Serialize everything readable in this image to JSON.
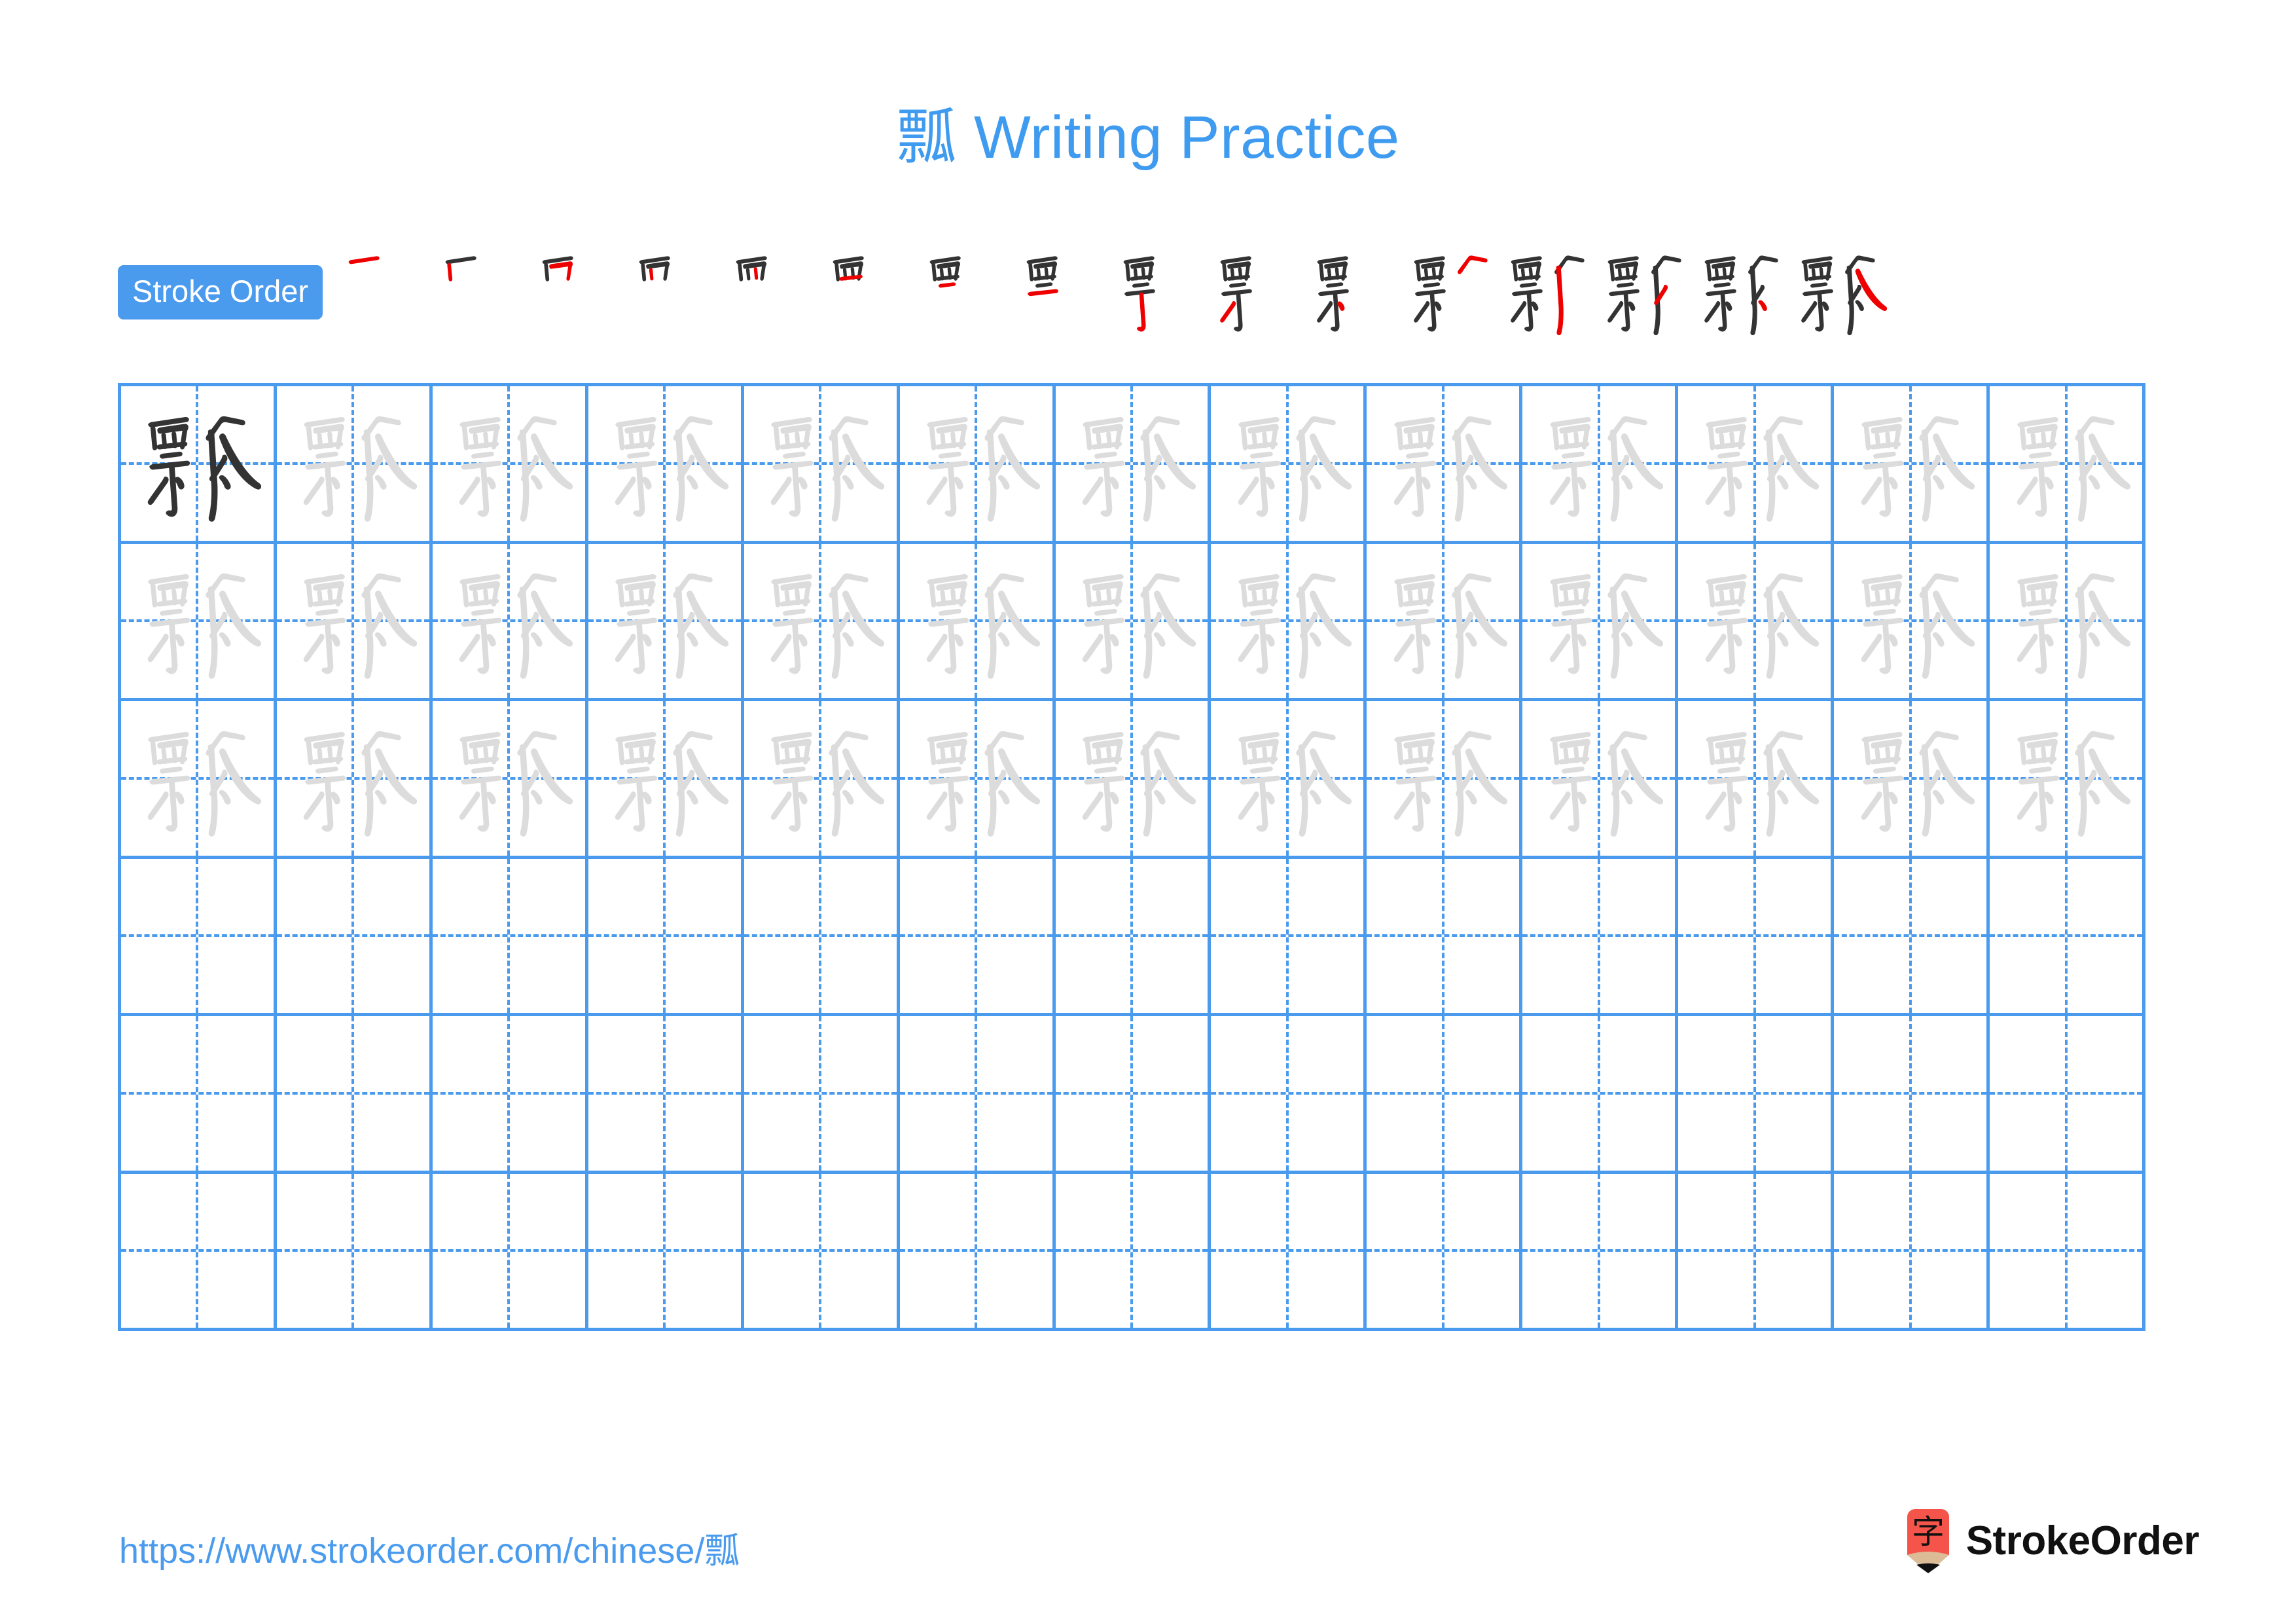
{
  "page": {
    "character": "瓢",
    "title": "瓢 Writing Practice",
    "title_suffix": " Writing Practice",
    "background_color": "#FFFFFF",
    "accent_color": "#4A9BEE",
    "title_color": "#3E9BF0"
  },
  "stroke_order": {
    "badge_label": "Stroke Order",
    "badge_bg": "#4A9BEE",
    "badge_text_color": "#FFFFFF",
    "total_strokes": 16,
    "existing_stroke_color": "#333333",
    "new_stroke_color": "#EE0000",
    "steps": [
      {
        "index": 1,
        "new_stroke": "horizontal top of 覀"
      },
      {
        "index": 2,
        "new_stroke": "left vertical of 覀"
      },
      {
        "index": 3,
        "new_stroke": "horizontal-fold-vertical of 覀"
      },
      {
        "index": 4,
        "new_stroke": "inner left vertical of 覀"
      },
      {
        "index": 5,
        "new_stroke": "inner right vertical of 覀"
      },
      {
        "index": 6,
        "new_stroke": "lower horizontal of 覀"
      },
      {
        "index": 7,
        "new_stroke": "short horizontal below 覀"
      },
      {
        "index": 8,
        "new_stroke": "second horizontal of 示"
      },
      {
        "index": 9,
        "new_stroke": "vertical hook of 示"
      },
      {
        "index": 10,
        "new_stroke": "left falling of 示"
      },
      {
        "index": 11,
        "new_stroke": "right dot of 示"
      },
      {
        "index": 12,
        "new_stroke": "left falling of 瓜"
      },
      {
        "index": 13,
        "new_stroke": "vertical of 瓜"
      },
      {
        "index": 14,
        "new_stroke": "inner left stroke of 瓜"
      },
      {
        "index": 15,
        "new_stroke": "inner dot of 瓜"
      },
      {
        "index": 16,
        "new_stroke": "final right falling of 瓜"
      }
    ]
  },
  "practice_grid": {
    "columns": 13,
    "rows": 6,
    "grid_line_color": "#4A9BEE",
    "guide_line_style": "dashed",
    "dark_glyph_color": "#333333",
    "trace_glyph_color": "#DCDCDC",
    "rows_data": [
      {
        "row": 1,
        "cells": [
          "dark",
          "trace",
          "trace",
          "trace",
          "trace",
          "trace",
          "trace",
          "trace",
          "trace",
          "trace",
          "trace",
          "trace",
          "trace"
        ]
      },
      {
        "row": 2,
        "cells": [
          "trace",
          "trace",
          "trace",
          "trace",
          "trace",
          "trace",
          "trace",
          "trace",
          "trace",
          "trace",
          "trace",
          "trace",
          "trace"
        ]
      },
      {
        "row": 3,
        "cells": [
          "trace",
          "trace",
          "trace",
          "trace",
          "trace",
          "trace",
          "trace",
          "trace",
          "trace",
          "trace",
          "trace",
          "trace",
          "trace"
        ]
      },
      {
        "row": 4,
        "cells": [
          "empty",
          "empty",
          "empty",
          "empty",
          "empty",
          "empty",
          "empty",
          "empty",
          "empty",
          "empty",
          "empty",
          "empty",
          "empty"
        ]
      },
      {
        "row": 5,
        "cells": [
          "empty",
          "empty",
          "empty",
          "empty",
          "empty",
          "empty",
          "empty",
          "empty",
          "empty",
          "empty",
          "empty",
          "empty",
          "empty"
        ]
      },
      {
        "row": 6,
        "cells": [
          "empty",
          "empty",
          "empty",
          "empty",
          "empty",
          "empty",
          "empty",
          "empty",
          "empty",
          "empty",
          "empty",
          "empty",
          "empty"
        ]
      }
    ]
  },
  "footer": {
    "url": "https://www.strokeorder.com/chinese/瓢",
    "url_color": "#4A9BEE",
    "brand_name": "StrokeOrder",
    "brand_mark_character": "字",
    "brand_mark_body_color": "#F4544A",
    "brand_mark_wood_color": "#DCBC96",
    "brand_mark_tip_color": "#111111",
    "brand_text_color": "#111111"
  }
}
